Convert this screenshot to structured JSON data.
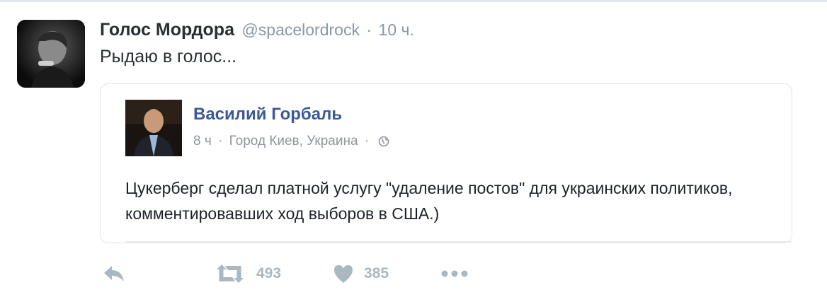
{
  "tweet": {
    "display_name": "Голос Мордора",
    "handle": "@spacelordrock",
    "separator": "·",
    "time": "10 ч.",
    "text": "Рыдаю в голос..."
  },
  "quoted_post": {
    "author": "Василий Горбаль",
    "time": "8 ч",
    "separator": "·",
    "location": "Город Киев, Украина",
    "separator2": "·",
    "text": "Цукерберг сделал платной услугу \"удаление постов\" для украинских политиков, комментировавших ход выборов в США.)"
  },
  "actions": {
    "retweet_count": "493",
    "like_count": "385"
  },
  "icons": {
    "reply": "reply-icon",
    "retweet": "retweet-icon",
    "like": "heart-icon",
    "more": "more-icon",
    "privacy": "globe-icon"
  },
  "colors": {
    "name": "#292f33",
    "muted": "#8899a6",
    "facebook_blue": "#3b5998",
    "action_gray": "#aab8c2"
  }
}
